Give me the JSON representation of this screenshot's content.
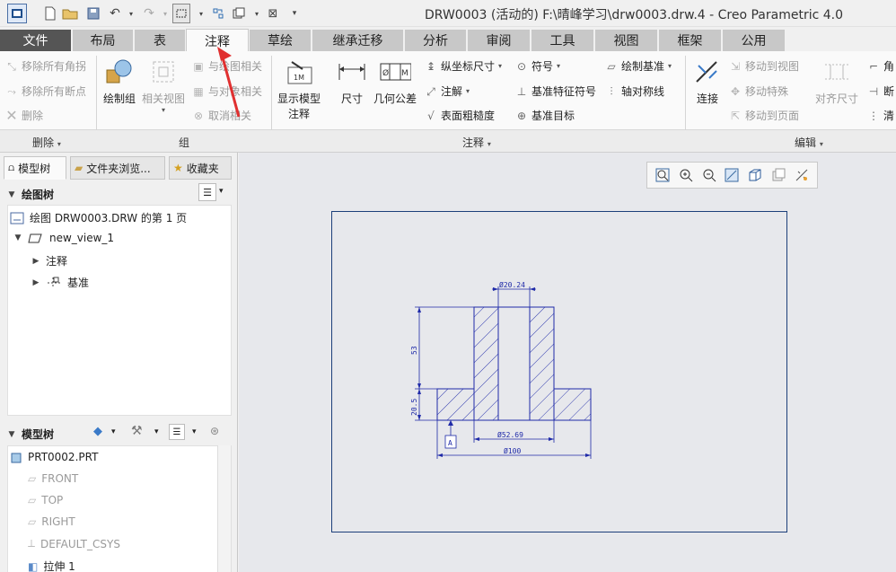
{
  "window": {
    "title": "DRW0003 (活动的) F:\\晴峰学习\\drw0003.drw.4 - Creo Parametric 4.0"
  },
  "tabs": [
    "文件",
    "布局",
    "表",
    "注释",
    "草绘",
    "继承迁移",
    "分析",
    "审阅",
    "工具",
    "视图",
    "框架",
    "公用"
  ],
  "ribbon": {
    "delete": {
      "items": [
        "移除所有角拐",
        "移除所有断点",
        "删除"
      ],
      "label": "删除"
    },
    "group": {
      "draw_group": "绘制组",
      "related_view": "相关视图",
      "related_items": [
        "与绘图相关",
        "与对象相关",
        "取消相关"
      ],
      "label": "组"
    },
    "annotate": {
      "show_model_line1": "显示模型",
      "show_model_line2": "注释",
      "dimension": "尺寸",
      "gtol": "几何公差",
      "ordinate": "纵坐标尺寸",
      "note": "注解",
      "surface_finish": "表面粗糙度",
      "symbol": "符号",
      "datum_feature": "基准特征符号",
      "datum_target": "基准目标",
      "draw_datum": "绘制基准",
      "sym_line": "轴对称线",
      "label": "注释"
    },
    "edit": {
      "connect": "连接",
      "move_to_view": "移动到视图",
      "move_special": "移动特殊",
      "move_to_page": "移动到页面",
      "align_dim": "对齐尺寸",
      "corner": "角",
      "break": "断",
      "clean": "清",
      "label": "编辑"
    }
  },
  "panel": {
    "tabs": [
      "模型树",
      "文件夹浏览...",
      "收藏夹"
    ],
    "drawing_tree": {
      "heading": "绘图树",
      "page_node": "绘图 DRW0003.DRW 的第 1 页",
      "view_node": "new_view_1",
      "children": [
        "注释",
        "基准"
      ]
    },
    "model_tree": {
      "heading": "模型树",
      "items": [
        "PRT0002.PRT",
        "FRONT",
        "TOP",
        "RIGHT",
        "DEFAULT_CSYS",
        "拉伸 1"
      ]
    }
  },
  "drawing": {
    "dims": [
      "Ø20.24",
      "53",
      "20.5",
      "Ø52.69",
      "Ø100"
    ],
    "datum_label": "A"
  },
  "colors": {
    "accent_red": "#e03030",
    "sheet_border": "#1c3f7a",
    "drawing_line": "#1f2aa8",
    "file_tab": "#555555"
  }
}
